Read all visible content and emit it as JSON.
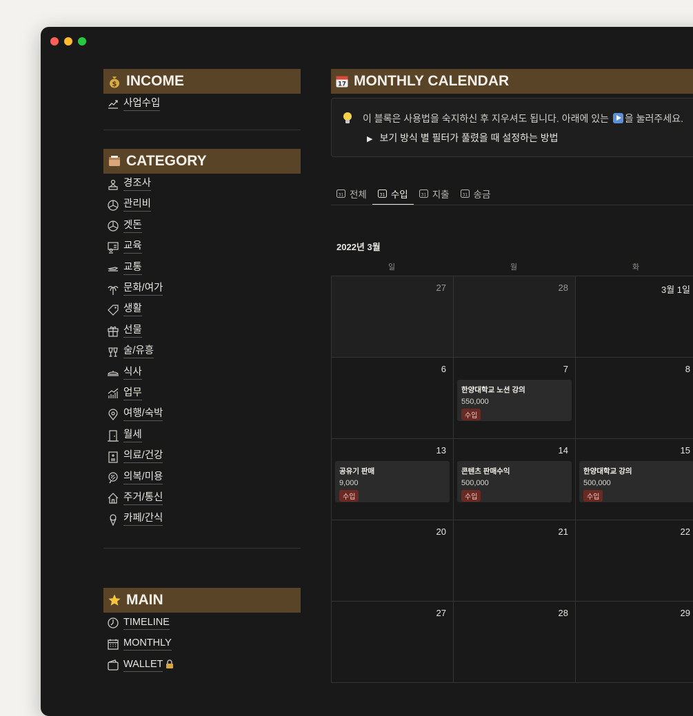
{
  "income": {
    "title": "INCOME",
    "items": [
      "사업수입"
    ]
  },
  "category": {
    "title": "CATEGORY",
    "items": [
      "경조사",
      "관리비",
      "겟돈",
      "교육",
      "교통",
      "문화/여가",
      "생활",
      "선물",
      "술/유흥",
      "식사",
      "업무",
      "여행/숙박",
      "월세",
      "의료/건강",
      "의복/미용",
      "주거/통신",
      "카페/간식"
    ]
  },
  "main": {
    "title": "MAIN",
    "items": [
      "TIMELINE",
      "MONTHLY",
      "WALLET"
    ]
  },
  "calendar": {
    "title": "MONTHLY CALENDAR",
    "callout_text_before": "이 블록은 사용법을 숙지하신 후 지우셔도 됩니다. 아래에 있는",
    "callout_text_after": "을 눌러주세요.",
    "toggle_text": "보기 방식 별 필터가 풀렸을 때 설정하는 방법",
    "tabs": [
      "전체",
      "수입",
      "지출",
      "송금"
    ],
    "active_tab": "수입",
    "month_label": "2022년 3월",
    "weekdays": [
      "일",
      "월",
      "화"
    ],
    "weeks": [
      [
        {
          "day": "27",
          "dim": true
        },
        {
          "day": "28",
          "dim": true
        },
        {
          "day": "3월 1일",
          "dim": false
        }
      ],
      [
        {
          "day": "6"
        },
        {
          "day": "7",
          "card": {
            "title": "한양대학교 노션 강의",
            "amount": "550,000",
            "tag": "수입"
          }
        },
        {
          "day": "8"
        }
      ],
      [
        {
          "day": "13",
          "card": {
            "title": "공유기 판매",
            "amount": "9,000",
            "tag": "수입"
          }
        },
        {
          "day": "14",
          "card": {
            "title": "콘텐츠 판매수익",
            "amount": "500,000",
            "tag": "수입"
          }
        },
        {
          "day": "15",
          "card": {
            "title": "한양대학교 강의",
            "amount": "500,000",
            "tag": "수입"
          }
        }
      ],
      [
        {
          "day": "20"
        },
        {
          "day": "21"
        },
        {
          "day": "22"
        }
      ],
      [
        {
          "day": "27"
        },
        {
          "day": "28"
        },
        {
          "day": "29"
        }
      ]
    ]
  },
  "colors": {
    "header_bg": "#5a4427",
    "page_bg": "#191919",
    "tag_bg": "#6a2a23"
  }
}
